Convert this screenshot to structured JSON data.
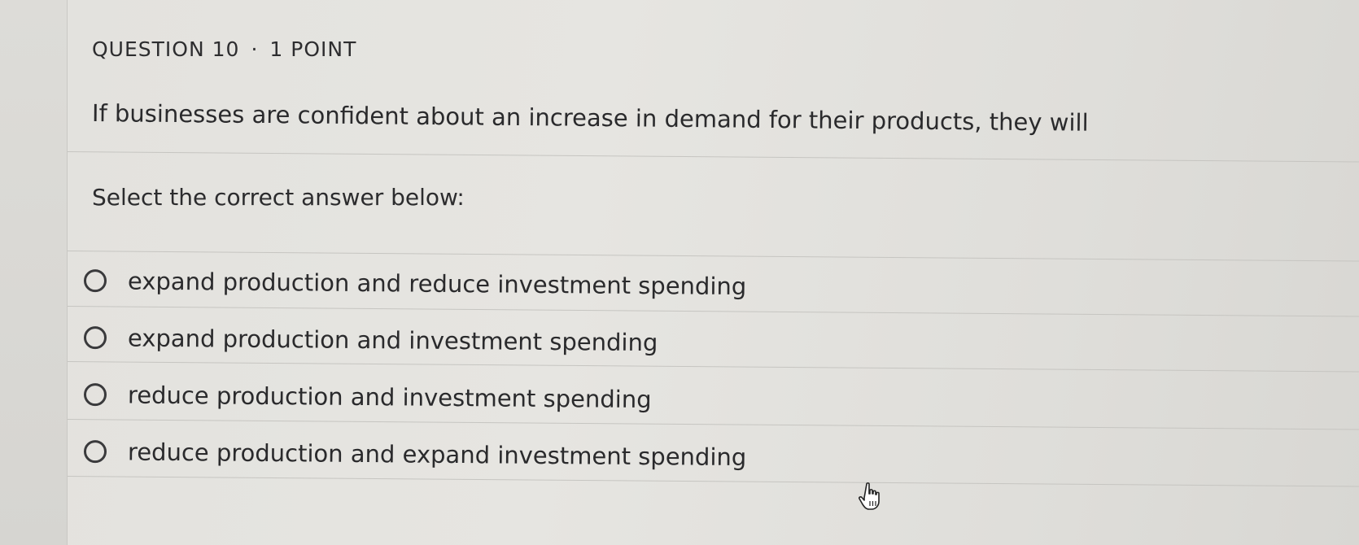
{
  "question": {
    "number_label": "QUESTION 10",
    "separator": "·",
    "points_label": "1 POINT",
    "text": "If businesses are confident about an increase in demand for their products, they will"
  },
  "prompt": "Select the correct answer below:",
  "options": [
    {
      "label": "expand production and reduce investment spending",
      "selected": false
    },
    {
      "label": "expand production and investment spending",
      "selected": false
    },
    {
      "label": "reduce production and investment spending",
      "selected": false
    },
    {
      "label": "reduce production and expand investment spending",
      "selected": false
    }
  ],
  "icons": {
    "radio": "radio-unchecked-icon",
    "cursor": "hand-pointer-icon"
  },
  "colors": {
    "text": "#2a2a2c",
    "divider": "#c6c5c1",
    "background": "#e3e2de"
  }
}
